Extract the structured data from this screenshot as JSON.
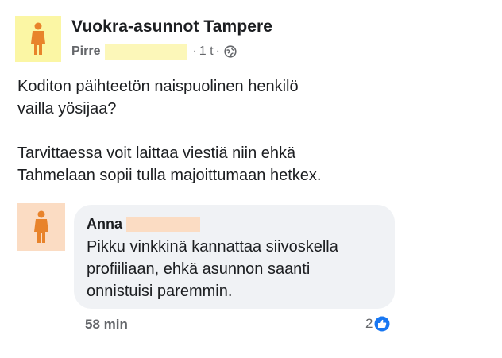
{
  "post": {
    "group_name": "Vuokra-asunnot Tampere",
    "author": "Pirre",
    "time": "1 t",
    "separator": "·",
    "privacy_icon": "globe-icon",
    "paragraph_1": "Koditon päihteetön naispuolinen henkilö\nvaailla yösijaa?",
    "paragraph_2": "Tarvittaessa voit laittaa viestiä niin ehkä\nTahmelaan sopii tulla majoittumaan hetkex."
  },
  "comment": {
    "author": "Anna",
    "text": "Pikku vinkkinä kannattaa siivoskella\nprofiiliaan, ehkä asunnon saanti\nonnistuisi paremmin.",
    "time": "58 min",
    "reaction_count": "2",
    "reaction_icon": "like-icon"
  },
  "colors": {
    "post_avatar_bg": "#fbf6a4",
    "post_redaction": "#fcf7b9",
    "comment_avatar_bg": "#fbdcc3",
    "person_icon_orange": "#e8832b",
    "like_blue": "#1877f2",
    "bubble_bg": "#f0f2f5",
    "meta_gray": "#65676b"
  }
}
